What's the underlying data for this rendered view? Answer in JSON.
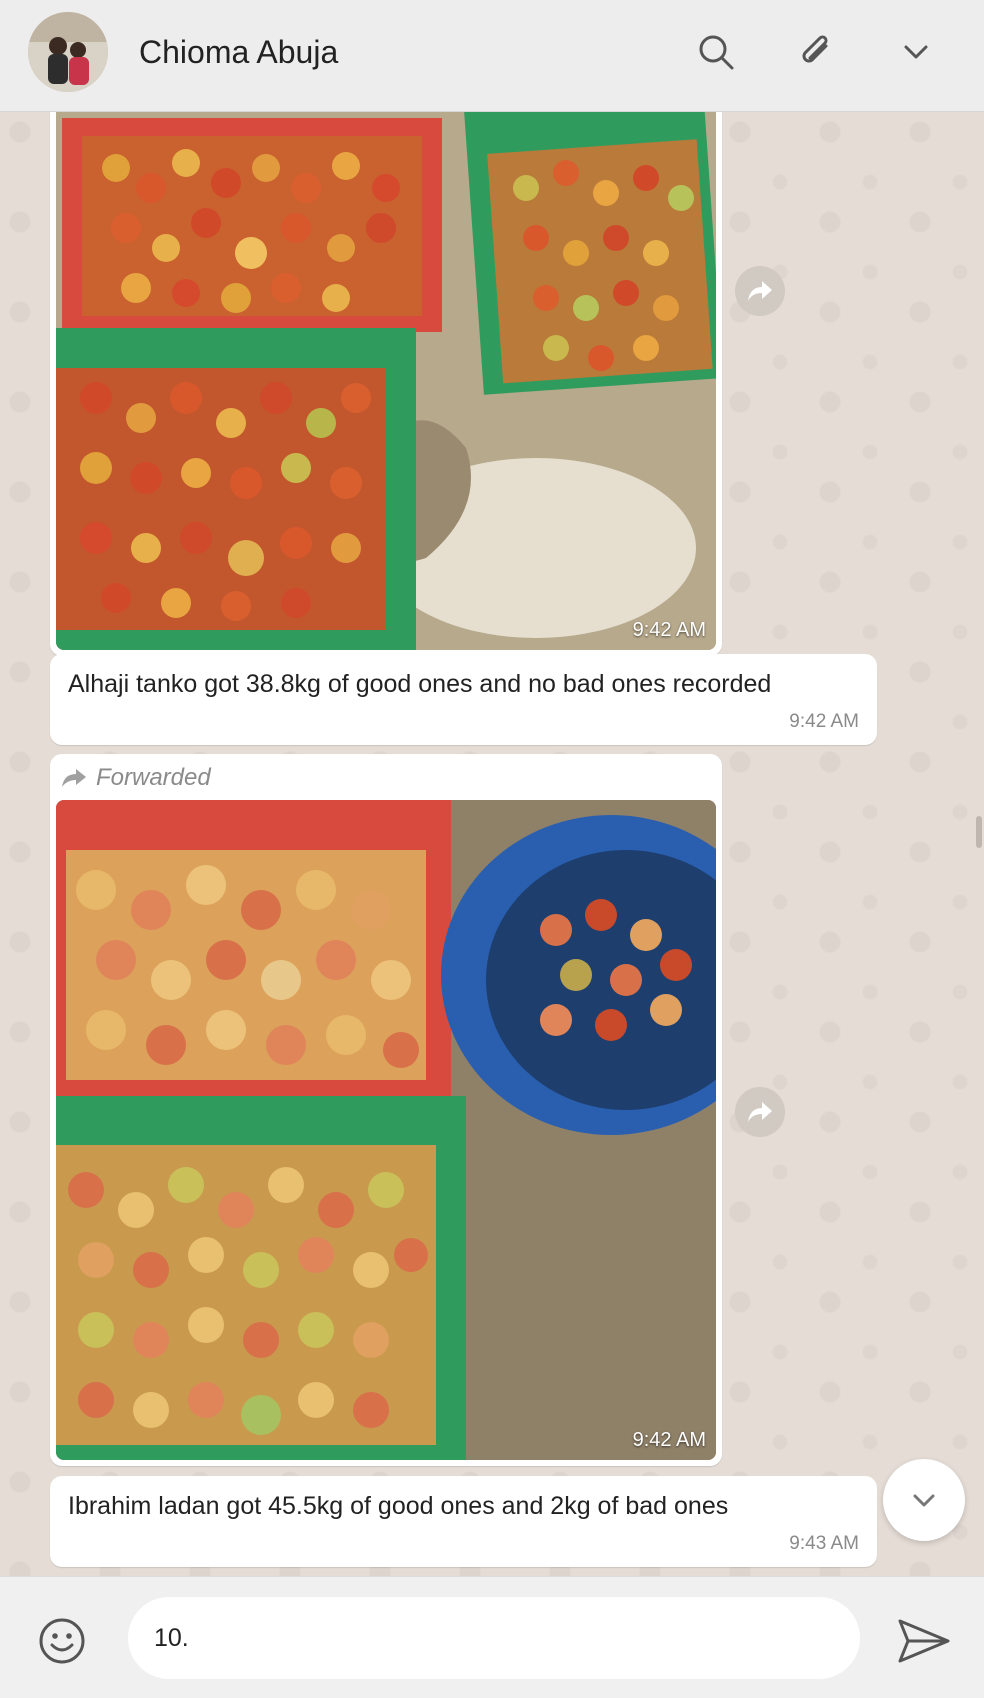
{
  "header": {
    "contact_name": "Chioma Abuja",
    "icons": [
      "search-icon",
      "attach-icon",
      "chevron-down-icon"
    ]
  },
  "messages": [
    {
      "type": "image",
      "time": "9:42 AM"
    },
    {
      "type": "text",
      "text": "Alhaji tanko got 38.8kg of good ones and no bad ones recorded",
      "time": "9:42 AM"
    },
    {
      "type": "image",
      "forwarded_label": "Forwarded",
      "time": "9:42 AM"
    },
    {
      "type": "text",
      "text": "Ibrahim ladan got 45.5kg of good ones and 2kg of bad ones",
      "time": "9:43 AM"
    }
  ],
  "composer": {
    "input_value": "10."
  },
  "colors": {
    "chat_bg": "#e5ddd5",
    "header_bg": "#ededed",
    "bubble_bg": "#ffffff",
    "crate_red": "#d94a3e",
    "crate_green": "#2f9c5e",
    "basin_blue": "#2a5fb0"
  }
}
